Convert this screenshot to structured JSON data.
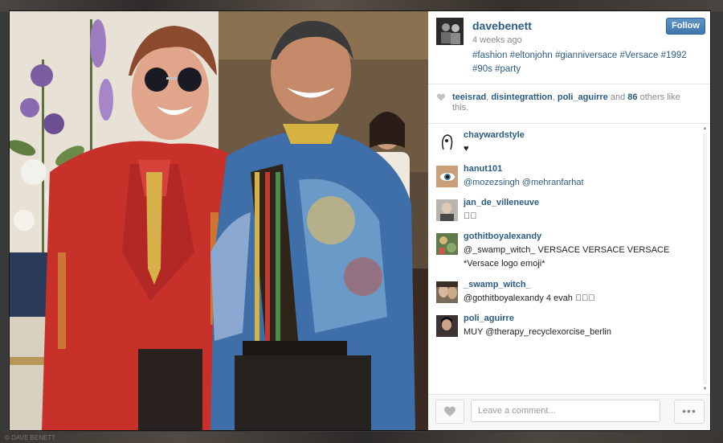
{
  "post": {
    "author": "davebenett",
    "time_ago": "4 weeks ago",
    "caption": "#fashion #eltonjohn #gianniversace #Versace #1992 #90s #party",
    "follow_label": "Follow"
  },
  "likes": {
    "likers": [
      "teeisrad",
      "disintegrattion",
      "poli_aguirre"
    ],
    "separator": ", ",
    "suffix_pre": " and ",
    "others_count": "86",
    "suffix_post": " others like this."
  },
  "comments": [
    {
      "user": "chaywardstyle",
      "text": "♥",
      "avatar_color": "#ffffff"
    },
    {
      "user": "hanut101",
      "text": "@mozezsingh @mehranfarhat",
      "avatar_color": "#6b8a9b"
    },
    {
      "user": "jan_de_villeneuve",
      "text": "􀀀􀀀",
      "avatar_color": "#8d8a86"
    },
    {
      "user": "gothitboyalexandy",
      "text": "@_swamp_witch_ VERSACE VERSACE VERSACE *Versace logo emoji*",
      "avatar_color": "#5f7b4c"
    },
    {
      "user": "_swamp_witch_",
      "text": "@gothitboyalexandy 4 evah 􀀀􀀀􀀀",
      "avatar_color": "#7a6a5a"
    },
    {
      "user": "poli_aguirre",
      "text": "MUY @therapy_recyclexorcise_berlin",
      "avatar_color": "#3b3432"
    }
  ],
  "composer": {
    "placeholder": "Leave a comment...",
    "more_label": "•••"
  },
  "background": {
    "watermark": "© DAVE BENETT"
  },
  "colors": {
    "link_blue": "#2a5b83",
    "follow_button": "#4a80b6",
    "jacket_red": "#c8302a"
  }
}
